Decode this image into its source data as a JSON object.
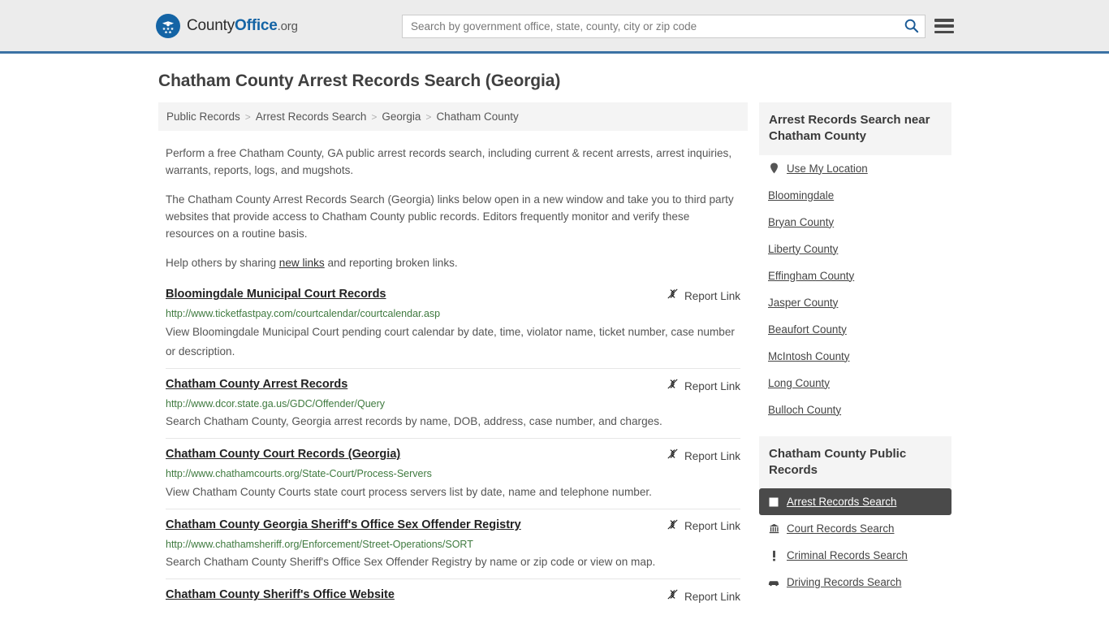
{
  "header": {
    "brand": {
      "part1": "County",
      "part2": "Office",
      "part3": ".org",
      "icon": "eagle-seal-icon"
    },
    "search": {
      "placeholder": "Search by government office, state, county, city or zip code",
      "value": "",
      "search_icon": "search-icon"
    },
    "menu_icon": "hamburger-menu-icon"
  },
  "page": {
    "title": "Chatham County Arrest Records Search (Georgia)"
  },
  "breadcrumb": {
    "separator": ">",
    "items": [
      {
        "label": "Public Records"
      },
      {
        "label": "Arrest Records Search"
      },
      {
        "label": "Georgia"
      },
      {
        "label": "Chatham County"
      }
    ]
  },
  "intro": {
    "p1": "Perform a free Chatham County, GA public arrest records search, including current & recent arrests, arrest inquiries, warrants, reports, logs, and mugshots.",
    "p2": "The Chatham County Arrest Records Search (Georgia) links below open in a new window and take you to third party websites that provide access to Chatham County public records. Editors frequently monitor and verify these resources on a routine basis.",
    "p3_pre": "Help others by sharing ",
    "p3_link": "new links",
    "p3_post": " and reporting broken links."
  },
  "results": {
    "report_label": "Report Link",
    "report_icon": "broken-link-icon",
    "items": [
      {
        "title": "Bloomingdale Municipal Court Records",
        "url": "http://www.ticketfastpay.com/courtcalendar/courtcalendar.asp",
        "description": "View Bloomingdale Municipal Court pending court calendar by date, time, violator name, ticket number, case number or description."
      },
      {
        "title": "Chatham County Arrest Records",
        "url": "http://www.dcor.state.ga.us/GDC/Offender/Query",
        "description": "Search Chatham County, Georgia arrest records by name, DOB, address, case number, and charges."
      },
      {
        "title": "Chatham County Court Records (Georgia)",
        "url": "http://www.chathamcourts.org/State-Court/Process-Servers",
        "description": "View Chatham County Courts state court process servers list by date, name and telephone number."
      },
      {
        "title": "Chatham County Georgia Sheriff's Office Sex Offender Registry",
        "url": "http://www.chathamsheriff.org/Enforcement/Street-Operations/SORT",
        "description": "Search Chatham County Sheriff's Office Sex Offender Registry by name or zip code or view on map."
      },
      {
        "title": "Chatham County Sheriff's Office Website",
        "url": "",
        "description": ""
      }
    ]
  },
  "sidebar": {
    "nearby": {
      "title": "Arrest Records Search near Chatham County",
      "items": [
        {
          "label": "Use My Location",
          "icon": "map-pin-icon"
        },
        {
          "label": "Bloomingdale",
          "icon": ""
        },
        {
          "label": "Bryan County",
          "icon": ""
        },
        {
          "label": "Liberty County",
          "icon": ""
        },
        {
          "label": "Effingham County",
          "icon": ""
        },
        {
          "label": "Jasper County",
          "icon": ""
        },
        {
          "label": "Beaufort County",
          "icon": ""
        },
        {
          "label": "McIntosh County",
          "icon": ""
        },
        {
          "label": "Long County",
          "icon": ""
        },
        {
          "label": "Bulloch County",
          "icon": ""
        }
      ]
    },
    "public_records": {
      "title": "Chatham County Public Records",
      "items": [
        {
          "label": "Arrest Records Search",
          "icon": "square-badge-icon",
          "active": true
        },
        {
          "label": "Court Records Search",
          "icon": "courthouse-icon",
          "active": false
        },
        {
          "label": "Criminal Records Search",
          "icon": "exclamation-icon",
          "active": false
        },
        {
          "label": "Driving Records Search",
          "icon": "car-icon",
          "active": false
        }
      ]
    }
  },
  "colors": {
    "brand_blue": "#1464a5",
    "header_bg": "#ececec",
    "header_rule": "#3b72a4",
    "url_green": "#3f7a3f",
    "active_bg": "#4a4a4a",
    "panel_bg": "#f4f4f4"
  }
}
